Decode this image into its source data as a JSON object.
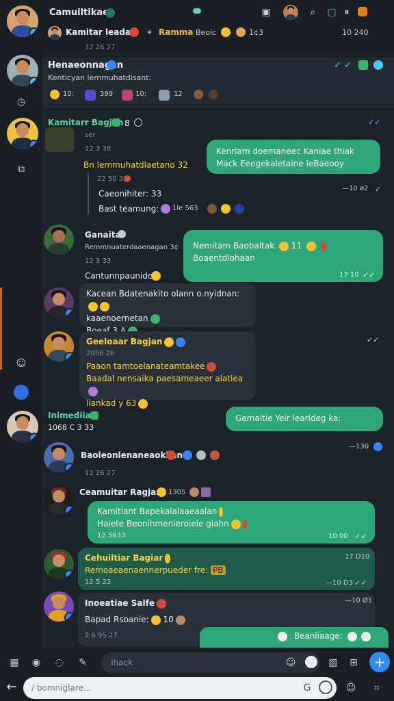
{
  "header": {
    "title": "Camuiltikae",
    "subtitle_name": "Kamitar leadan",
    "subtitle_tag": "Ramma",
    "subtitle_extra": "Beoic",
    "subtitle_count": "1¢3",
    "subtitle_time": "10 240",
    "date": "12 26 27"
  },
  "pinned": {
    "title": "Henaeonnagan",
    "subtitle": "Kenticyan lemmuhatdisant:",
    "stats": [
      "10;",
      "399",
      "10;",
      "12"
    ],
    "tick": "✓ ✓"
  },
  "messages": [
    {
      "id": "m1",
      "name": "Kamitarr Bagjan",
      "suffix": "8",
      "sub": "ser",
      "time": "12 3 38",
      "title": "Bn lemmuhatdlaetano 32",
      "reply_time": "22 50 33",
      "reply_name": "Caeonihiter: 33",
      "reply_line": "Bast teamung:",
      "reply_stats": "1le  563",
      "out_text": "Kenriam doemaneec Kaniae thiak Mack Eeegekaletaine IeBaeooy",
      "out_time": "—10 ø2"
    },
    {
      "id": "m2",
      "name": "Ganaita",
      "line1": "Remmnuaterdaaenagan 3¢",
      "time": "12 3 33",
      "line2": "Cantunnpaunidct",
      "out_text1": "Nemitam Baobaltak",
      "out_count": "11",
      "out_text2": "Boaentdlohaan",
      "out_time": "17 10"
    },
    {
      "id": "m3",
      "text1": "Kacean Bdatenakito olann o.nyidnan:",
      "text2": "kaaenoernetan",
      "time": "Boeaf 3 A"
    },
    {
      "id": "m4",
      "name": "Geeloaar Bagjan",
      "sub": "2056 28",
      "line1": "Paaon tamtoelanateamtakee",
      "line2": "Baadal nensaika paesameaeer alatiea",
      "line3": "liankad y 63"
    },
    {
      "id": "m5",
      "name": "Inimediian",
      "sub": "1068 C  3 33",
      "out_text": "Gemaitie Yeir learldeg ka:",
      "out_time": "—130"
    },
    {
      "id": "m6",
      "name": "Baoleonlenaneaokkan",
      "time": "12 26 27"
    },
    {
      "id": "m7",
      "name": "Ceamuitar Ragjan",
      "count": "1305",
      "out_text1": "Kamitiant Bapekalalaaeaalan",
      "out_text2": "Haiete Beonihmenieroieie giahn",
      "out_date": "12 5833",
      "out_time": "10 00"
    },
    {
      "id": "m8",
      "name": "Cehuiltiar Bagiar",
      "sub": "Remoaeaenaennerpueder fre:",
      "tag": "PB",
      "date": "12 5 23",
      "time_top": "17 D10",
      "time": "—10 D3"
    },
    {
      "id": "m9",
      "name": "Inoeatiae Salfe",
      "line": "Bapad Rsoanie:",
      "count": "10",
      "date": "2 6 95 27",
      "time": "—10 Ø1"
    }
  ],
  "tail_bubble": "Beanliaage:",
  "composer": {
    "placeholder": "Ihack",
    "bottom_placeholder": "/ bomniglare..."
  },
  "colors": {
    "bubble_out": "#2fa57a",
    "bubble_in": "#2a3039",
    "accent": "#2f8df0",
    "bg": "#1c2229"
  }
}
